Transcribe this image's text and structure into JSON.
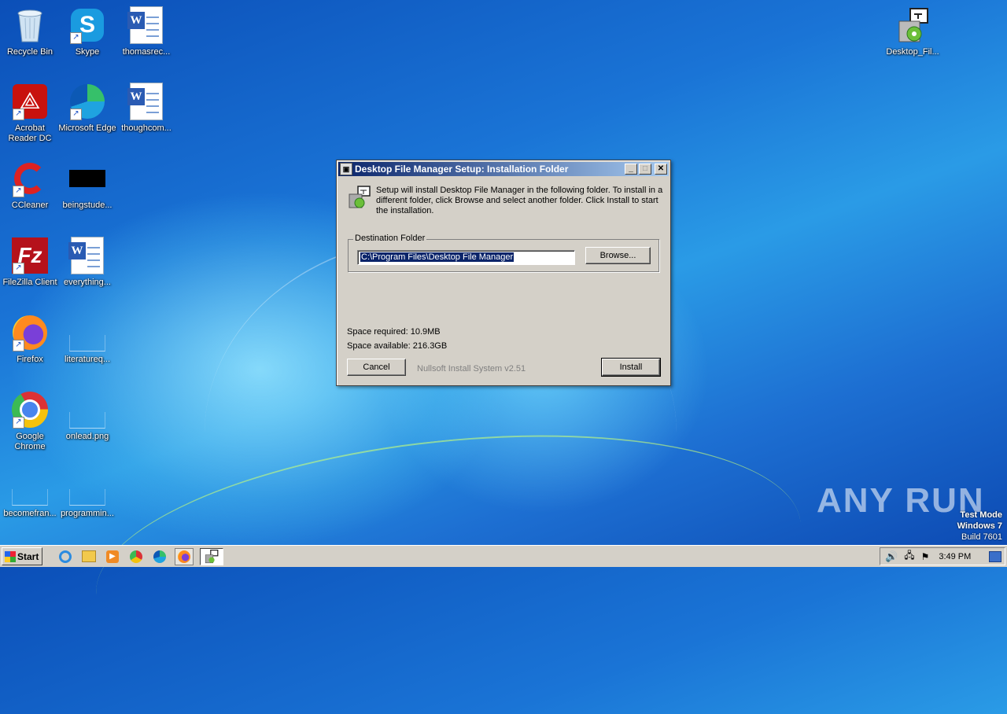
{
  "desktop": {
    "icons": [
      {
        "id": "recycle-bin",
        "label": "Recycle Bin"
      },
      {
        "id": "skype",
        "label": "Skype"
      },
      {
        "id": "thomasrec",
        "label": "thomasrec..."
      },
      {
        "id": "acrobat",
        "label": "Acrobat Reader DC"
      },
      {
        "id": "edge",
        "label": "Microsoft Edge"
      },
      {
        "id": "thoughcom",
        "label": "thoughcom..."
      },
      {
        "id": "ccleaner",
        "label": "CCleaner"
      },
      {
        "id": "beingstude",
        "label": "beingstude..."
      },
      {
        "id": "filezilla",
        "label": "FileZilla Client"
      },
      {
        "id": "everything",
        "label": "everything..."
      },
      {
        "id": "firefox",
        "label": "Firefox"
      },
      {
        "id": "literatureq",
        "label": "literatureq..."
      },
      {
        "id": "chrome",
        "label": "Google Chrome"
      },
      {
        "id": "onlead",
        "label": "onlead.png"
      },
      {
        "id": "becomefran",
        "label": "becomefran..."
      },
      {
        "id": "programmin",
        "label": "programmin..."
      },
      {
        "id": "desktop-fil",
        "label": "Desktop_Fil..."
      }
    ]
  },
  "dialog": {
    "title": "Desktop File Manager Setup: Installation Folder",
    "message": "Setup will install Desktop File Manager in the following folder. To install in a different folder, click Browse and select another folder. Click Install to start the installation.",
    "group_label": "Destination Folder",
    "path_value": "C:\\Program Files\\Desktop File Manager",
    "browse_label": "Browse...",
    "space_required": "Space required: 10.9MB",
    "space_available": "Space available: 216.3GB",
    "cancel_label": "Cancel",
    "branding": "Nullsoft Install System v2.51",
    "install_label": "Install",
    "minimize_glyph": "_",
    "maximize_glyph": "□",
    "close_glyph": "✕"
  },
  "taskbar": {
    "start_label": "Start",
    "clock": "3:49 PM",
    "apps": [
      "ie-icon",
      "explorer-icon",
      "media-player-icon",
      "chrome-icon",
      "edge-icon",
      "firefox-icon",
      "installer-icon"
    ]
  },
  "watermark": {
    "line1": "Test Mode",
    "line2": "Windows 7",
    "line3": "Build 7601",
    "brand": "ANY RUN"
  }
}
